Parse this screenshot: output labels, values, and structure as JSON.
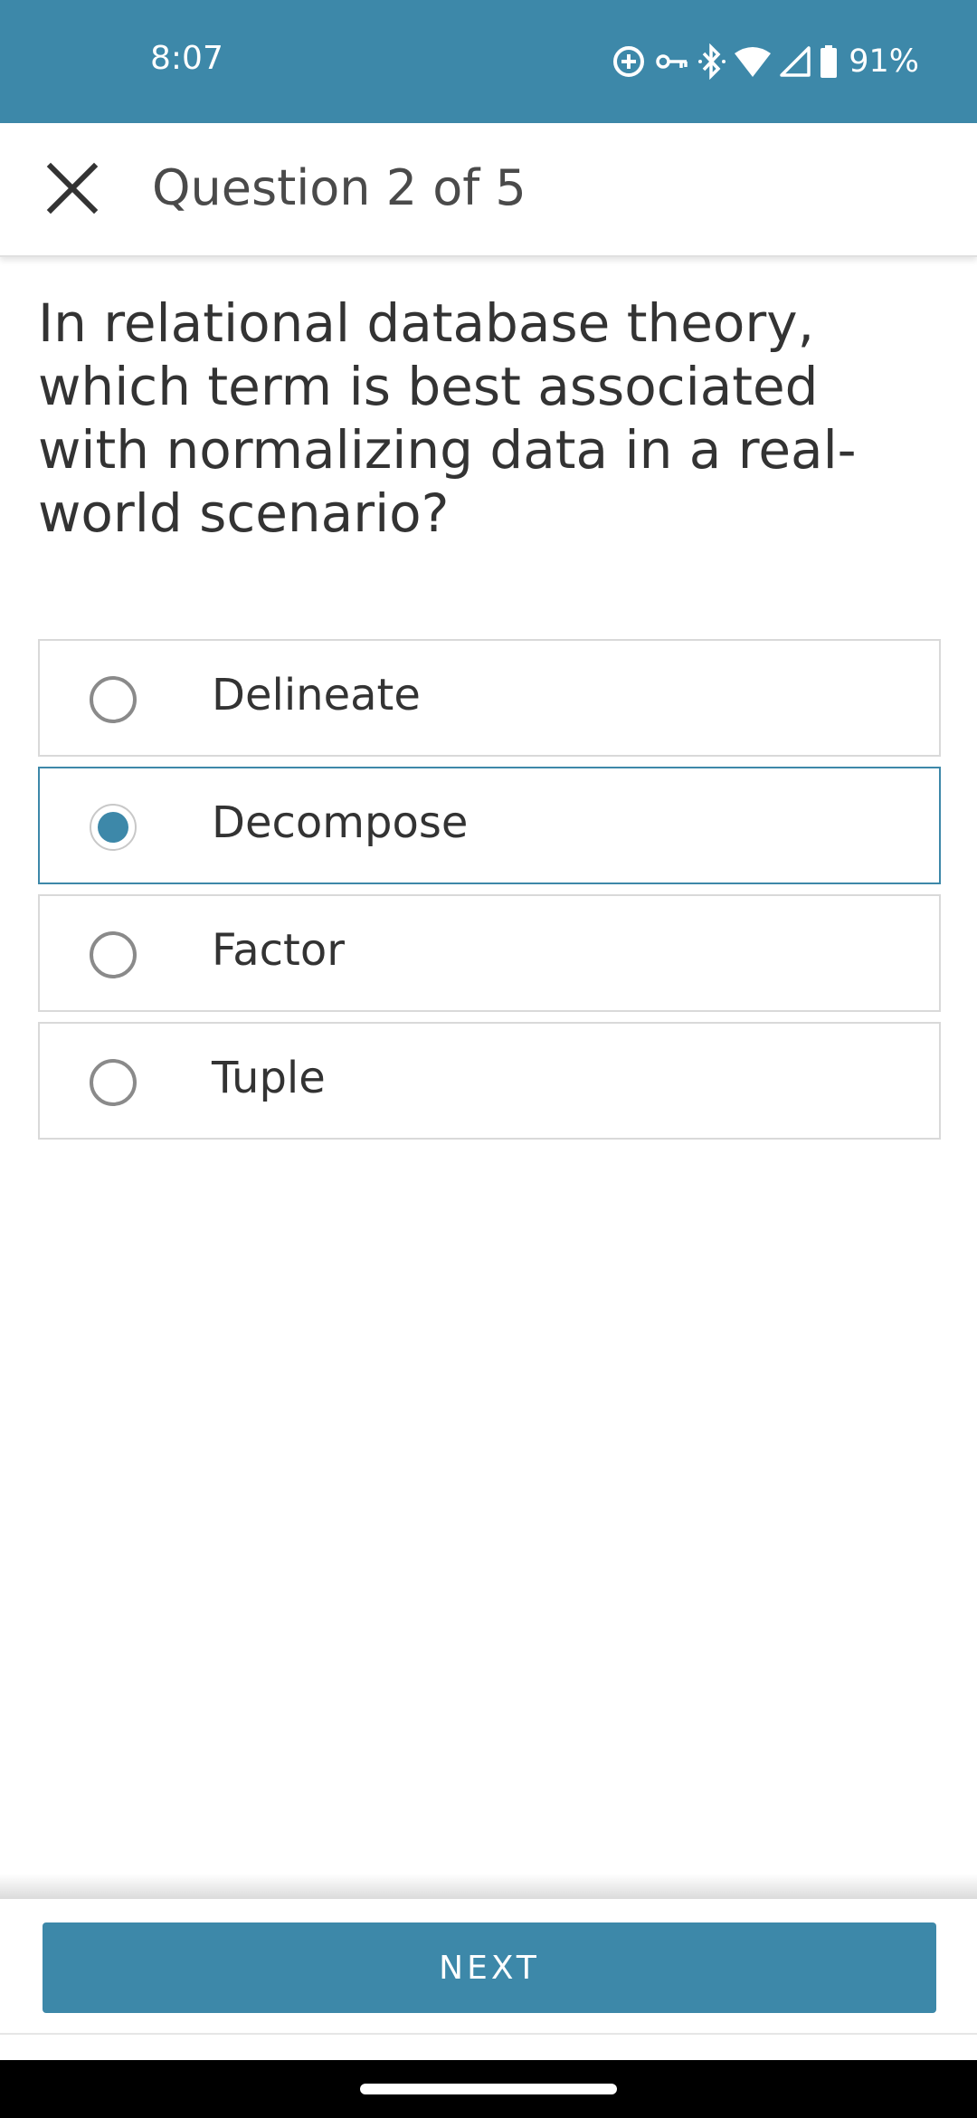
{
  "status_bar": {
    "time": "8:07",
    "battery": "91%",
    "icons": [
      "sync-icon",
      "vpn-key-icon",
      "bluetooth-icon",
      "wifi-icon",
      "cell-signal-icon",
      "battery-icon"
    ]
  },
  "header": {
    "title": "Question 2 of 5",
    "close_icon": "close-icon"
  },
  "question": {
    "text": "In relational database theory, which term is best associated with normalizing data in a real-world scenario?"
  },
  "options": [
    {
      "label": "Delineate",
      "selected": false
    },
    {
      "label": "Decompose",
      "selected": true
    },
    {
      "label": "Factor",
      "selected": false
    },
    {
      "label": "Tuple",
      "selected": false
    }
  ],
  "footer": {
    "next_label": "NEXT"
  },
  "colors": {
    "accent": "#3d88a9",
    "border": "#d9d9d9",
    "text": "#333333"
  }
}
